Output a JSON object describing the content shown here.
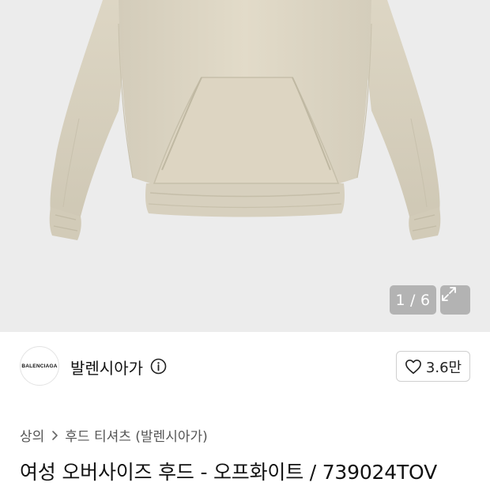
{
  "gallery": {
    "current": "1",
    "separator": "/",
    "total": "6",
    "background": "#ececec",
    "garment_color": "#dcd5c4"
  },
  "brand": {
    "logo_text": "BALENCIAGA",
    "name": "발렌시아가",
    "info_icon": "info-icon"
  },
  "like": {
    "icon": "heart-icon",
    "count": "3.6만"
  },
  "breadcrumb": {
    "items": [
      "상의",
      "후드 티셔츠 (발렌시아가)"
    ],
    "separator_icon": "chevron-right-icon"
  },
  "product": {
    "title": "여성 오버사이즈 후드 - 오프화이트 / 739024TOV"
  }
}
